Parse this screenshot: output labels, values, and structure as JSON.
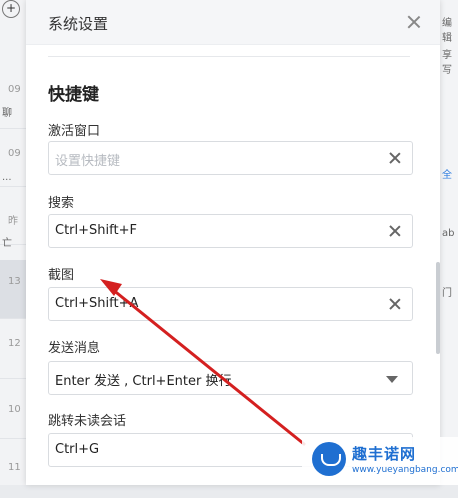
{
  "background": {
    "left_times": [
      "09",
      "09",
      "昨",
      "13",
      "12",
      "10",
      "11"
    ],
    "left_snips": [
      "聊",
      "...",
      "亡",
      "",
      "",
      "",
      ""
    ],
    "right_snips": [
      "编辑",
      "享写",
      "全",
      "ab",
      "门"
    ]
  },
  "dialog": {
    "title": "系统设置",
    "section_title": "快捷键",
    "fields": [
      {
        "label": "激活窗口",
        "value": "",
        "placeholder": "设置快捷键",
        "control": "clear"
      },
      {
        "label": "搜索",
        "value": "Ctrl+Shift+F",
        "placeholder": "",
        "control": "clear"
      },
      {
        "label": "截图",
        "value": "Ctrl+Shift+A",
        "placeholder": "",
        "control": "clear"
      },
      {
        "label": "发送消息",
        "value": "Enter 发送 , Ctrl+Enter 换行",
        "placeholder": "",
        "control": "dropdown"
      },
      {
        "label": "跳转未读会话",
        "value": "Ctrl+G",
        "placeholder": "",
        "control": "clear"
      }
    ]
  },
  "annotation": {
    "color": "#d42020"
  },
  "watermark": {
    "name": "趣丰诺网",
    "url": "www.yueyangbang.com"
  }
}
